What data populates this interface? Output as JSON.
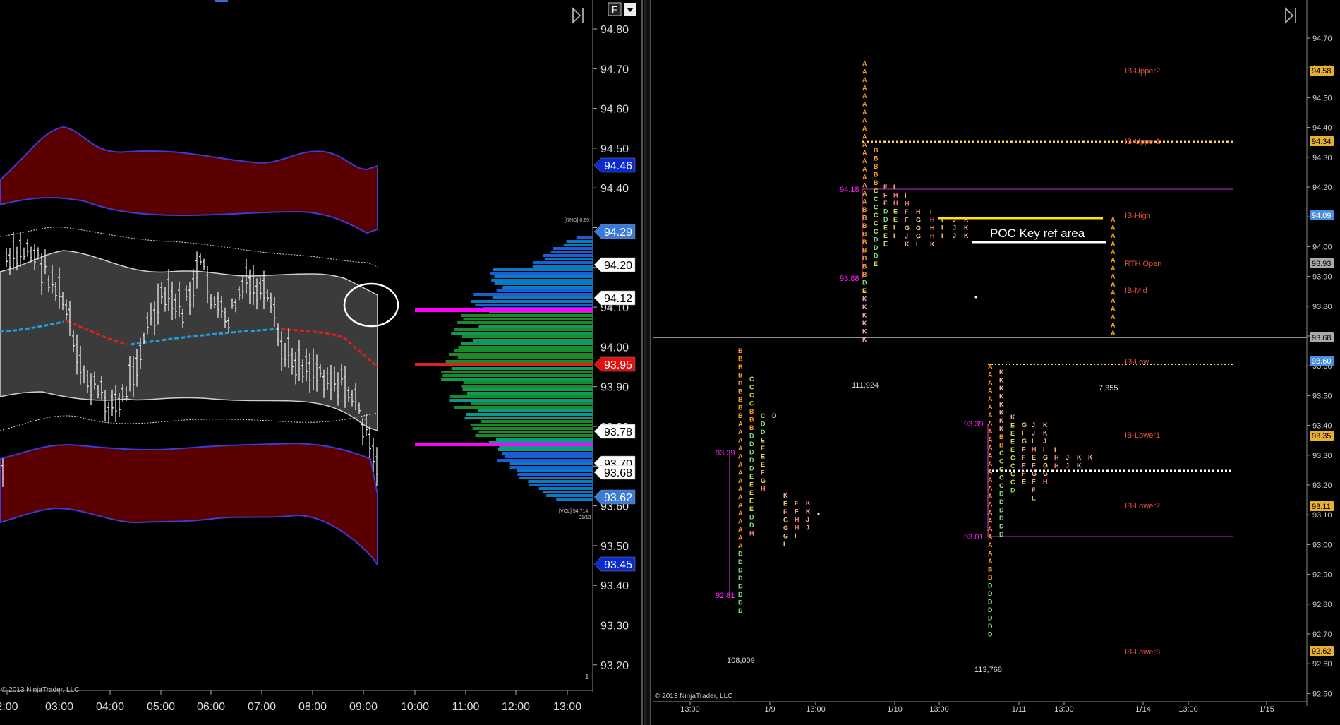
{
  "left_chart": {
    "copyright": "© 2013 NinjaTrader, LLC",
    "f_button": "F",
    "corner_num": "1",
    "rng_label": "[RNG] 0.69",
    "vol_label": "[VOL] 54,714",
    "vol_date": "01/13",
    "price_axis": [
      "94.80",
      "94.70",
      "94.60",
      "94.50",
      "94.40",
      "94.30",
      "94.20",
      "94.10",
      "94.00",
      "93.90",
      "93.80",
      "93.70",
      "93.60",
      "93.50",
      "93.40",
      "93.30",
      "93.20"
    ],
    "time_axis": [
      "2:00",
      "03:00",
      "04:00",
      "05:00",
      "06:00",
      "07:00",
      "08:00",
      "09:00",
      "10:00",
      "11:00",
      "12:00",
      "13:00"
    ],
    "price_markers": [
      {
        "text": "94.46",
        "style": "blue"
      },
      {
        "text": "94.29",
        "style": "lightblue"
      },
      {
        "text": "94.20",
        "style": "white"
      },
      {
        "text": "94.12",
        "style": "white"
      },
      {
        "text": "93.95",
        "style": "red"
      },
      {
        "text": "93.78",
        "style": "white"
      },
      {
        "text": "93.70",
        "style": "white"
      },
      {
        "text": "93.68",
        "style": "white"
      },
      {
        "text": "93.62",
        "style": "lightblue"
      },
      {
        "text": "93.45",
        "style": "blue"
      }
    ]
  },
  "right_chart": {
    "copyright": "© 2013 NinjaTrader, LLC",
    "price_axis": [
      "94.70",
      "94.60",
      "94.50",
      "94.40",
      "94.30",
      "94.20",
      "94.10",
      "94.00",
      "93.90",
      "93.80",
      "93.70",
      "93.60",
      "93.50",
      "93.40",
      "93.30",
      "93.20",
      "93.10",
      "93.00",
      "92.90",
      "92.80",
      "92.70",
      "92.60",
      "92.50"
    ],
    "time_axis": [
      "13:00",
      "1/9",
      "13:00",
      "1/10",
      "13:00",
      "1/11",
      "13:00",
      "1/14",
      "13:00",
      "1/15"
    ],
    "price_markers": [
      {
        "text": "94.58",
        "style": "gold"
      },
      {
        "text": "94.34",
        "style": "gold"
      },
      {
        "text": "94.09",
        "style": "lightblue"
      },
      {
        "text": "93.93",
        "style": "grey"
      },
      {
        "text": "93.68",
        "style": "grey"
      },
      {
        "text": "93.60",
        "style": "lightblue"
      },
      {
        "text": "93.35",
        "style": "gold"
      },
      {
        "text": "93.11",
        "style": "gold"
      },
      {
        "text": "92.62",
        "style": "gold"
      }
    ],
    "level_labels": [
      "IB-Upper2",
      "IB-Upper1",
      "IB-High",
      "RTH Open",
      "IB-Mid",
      "IB-Low",
      "IB-Lower1",
      "IB-Lower2",
      "IB-Lower3"
    ],
    "annotation": "POC Key ref area",
    "profile_prices": [
      "94.18",
      "93.88",
      "93.29",
      "92.81",
      "93.39",
      "93.01"
    ],
    "volume_labels": [
      "111,924",
      "7,355",
      "108,009",
      "113,768"
    ]
  },
  "colors": {
    "band": "#5a0000",
    "band_edge": "#3b3bd6",
    "vwap_blue": "#1ea0e0",
    "vwap_red": "#e02020",
    "magenta": "#ff00ff",
    "yellow": "#ffe600"
  }
}
